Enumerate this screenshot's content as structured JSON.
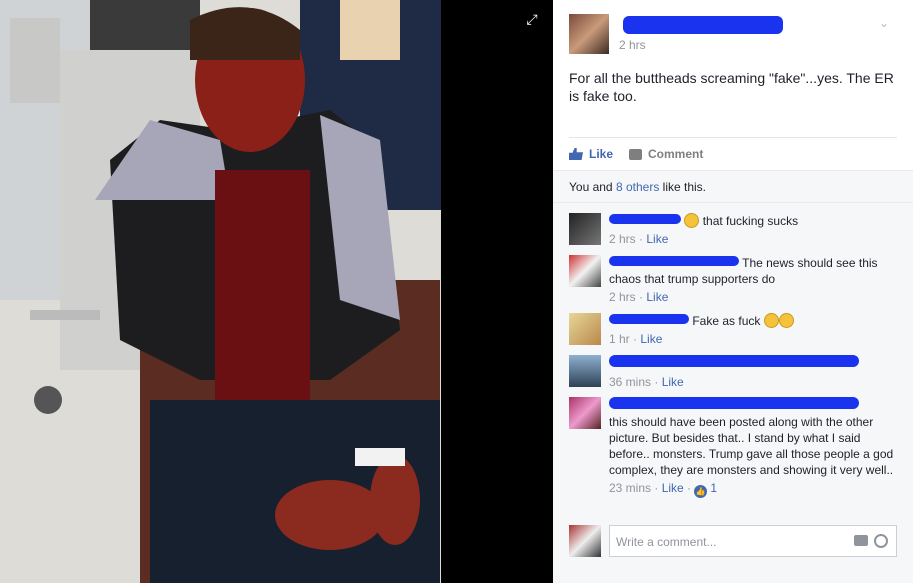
{
  "post": {
    "time": "2 hrs",
    "text": "For all the buttheads screaming \"fake\"...yes. The ER is fake too."
  },
  "actions": {
    "like": "Like",
    "comment": "Comment"
  },
  "likes": {
    "prefix": "You and ",
    "others": "8 others",
    "suffix": " like this."
  },
  "comments": [
    {
      "text": "that fucking sucks",
      "time": "2 hrs",
      "like": "Like"
    },
    {
      "text": "The news should see this chaos that trump supporters do",
      "time": "2 hrs",
      "like": "Like"
    },
    {
      "text": "Fake as fuck",
      "time": "1 hr",
      "like": "Like"
    },
    {
      "text": "",
      "time": "36 mins",
      "like": "Like"
    },
    {
      "text": "this should have been posted along with the other picture. But besides that.. I stand by what I said before.. monsters. Trump gave all those people a god complex, they are monsters and showing it very well..",
      "time": "23 mins",
      "like": "Like",
      "reactions": "1"
    }
  ],
  "composer": {
    "placeholder": "Write a comment..."
  },
  "colors": {
    "link": "#4267b2",
    "redaction": "#1a33ee"
  },
  "icons": [
    "expand-icon",
    "chevron-down-icon",
    "like-icon",
    "comment-icon",
    "camera-icon",
    "smile-icon"
  ]
}
